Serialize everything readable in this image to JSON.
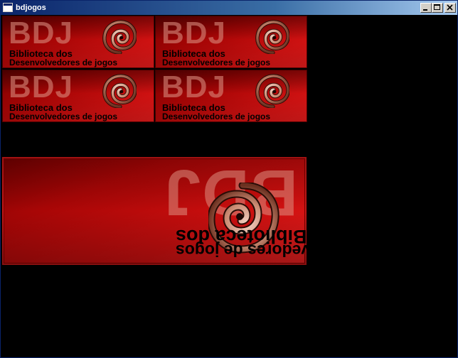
{
  "window": {
    "title": "bdjogos",
    "controls": {
      "minimize": "minimize-icon",
      "maximize": "maximize-icon",
      "close": "close-icon"
    }
  },
  "tiles": [
    {
      "logo": "BDJ",
      "line1": "Biblioteca dos",
      "line2": "Desenvolvedores de jogos"
    },
    {
      "logo": "BDJ",
      "line1": "Biblioteca dos",
      "line2": "Desenvolvedores de jogos"
    },
    {
      "logo": "BDJ",
      "line1": "Biblioteca dos",
      "line2": "Desenvolvedores de jogos"
    },
    {
      "logo": "BDJ",
      "line1": "Biblioteca dos",
      "line2": "Desenvolvedores de jogos"
    }
  ],
  "big_banner": {
    "logo": "BDJ",
    "line1": "Biblioteca dos",
    "line2": "Desenvolvedores de jogos",
    "orientation": "rotated-180"
  },
  "colors": {
    "title_bar_start": "#0a246a",
    "title_bar_end": "#a6caf0",
    "banner_red": "#d01010",
    "background": "#000000"
  }
}
